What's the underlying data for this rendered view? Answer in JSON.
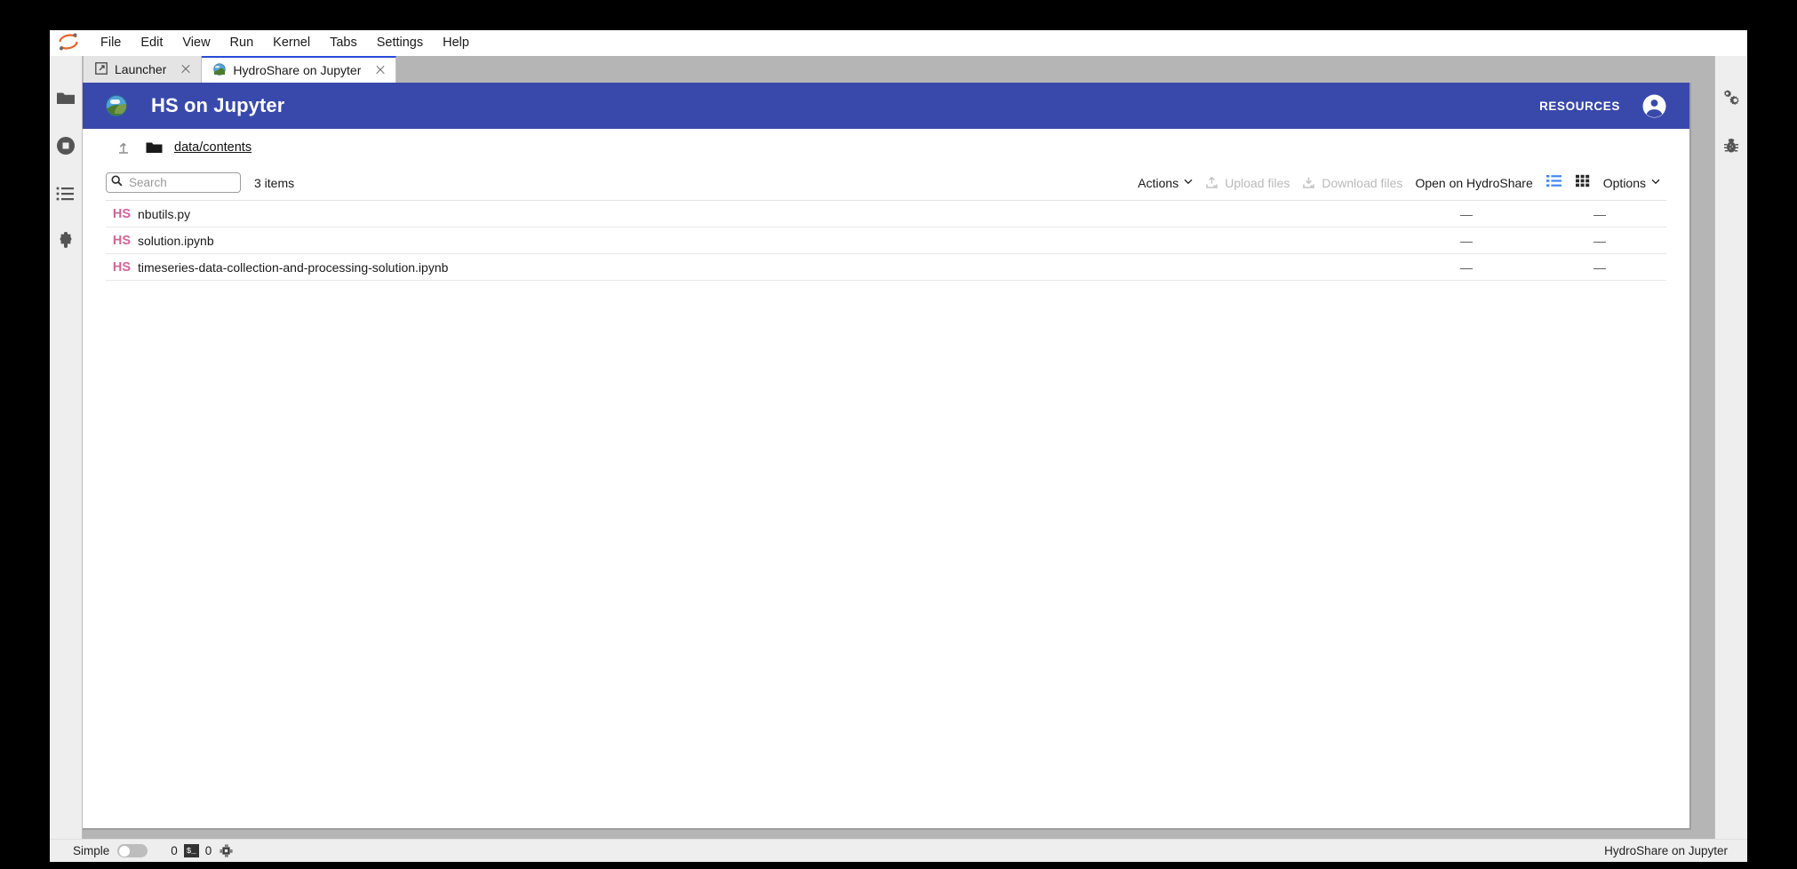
{
  "window": {
    "jupyter_logo": "jupyter-logo-icon"
  },
  "menubar": {
    "items": [
      {
        "label": "File"
      },
      {
        "label": "Edit"
      },
      {
        "label": "View"
      },
      {
        "label": "Run"
      },
      {
        "label": "Kernel"
      },
      {
        "label": "Tabs"
      },
      {
        "label": "Settings"
      },
      {
        "label": "Help"
      }
    ]
  },
  "tabs": [
    {
      "label": "Launcher",
      "icon": "launcher-icon",
      "active": false
    },
    {
      "label": "HydroShare on Jupyter",
      "icon": "hydroshare-globe-icon",
      "active": true
    }
  ],
  "left_sidebar": {
    "items": [
      {
        "name": "file-browser",
        "icon": "folder-icon"
      },
      {
        "name": "running-terminals-and-kernels",
        "icon": "stop-circle-icon"
      },
      {
        "name": "commands",
        "icon": "list-icon"
      },
      {
        "name": "extension-manager",
        "icon": "puzzle-piece-icon"
      }
    ]
  },
  "right_sidebar": {
    "items": [
      {
        "name": "property-inspector",
        "icon": "gears-icon"
      },
      {
        "name": "debugger",
        "icon": "bug-icon"
      }
    ]
  },
  "hs_header": {
    "logo_icon": "hydroshare-globe-icon",
    "title": "HS on Jupyter",
    "resources_label": "RESOURCES",
    "account_icon": "account-circle-icon",
    "background_color": "#3949ab"
  },
  "breadcrumb": {
    "up_icon": "arrow-up-icon",
    "folder_icon": "folder-icon",
    "path": "data/contents"
  },
  "toolbar": {
    "search": {
      "placeholder": "Search",
      "value": "",
      "icon": "search-icon"
    },
    "item_count": "3 items",
    "actions_label": "Actions",
    "upload_label": "Upload files",
    "upload_icon": "upload-icon",
    "upload_disabled": true,
    "download_label": "Download files",
    "download_icon": "download-icon",
    "download_disabled": true,
    "open_on_hydroshare_label": "Open on HydroShare",
    "list_view_icon": "list-view-icon",
    "grid_view_icon": "grid-view-icon",
    "list_view_active": true,
    "list_view_active_color": "#4285f4",
    "options_label": "Options",
    "caret": "⌄"
  },
  "files": {
    "badge_color": "#d2649a",
    "rows": [
      {
        "badge": "HS",
        "name": "nbutils.py",
        "col_a": "—",
        "col_b": "—"
      },
      {
        "badge": "HS",
        "name": "solution.ipynb",
        "col_a": "—",
        "col_b": "—"
      },
      {
        "badge": "HS",
        "name": "timeseries-data-collection-and-processing-solution.ipynb",
        "col_a": "—",
        "col_b": "—"
      }
    ]
  },
  "status_bar": {
    "simple_label": "Simple",
    "simple_on": false,
    "kernel_count": "0",
    "terminal_chip": "$_",
    "terminal_count": "0",
    "kernel_icon": "cpu-chip-icon",
    "right_label": "HydroShare on Jupyter"
  }
}
